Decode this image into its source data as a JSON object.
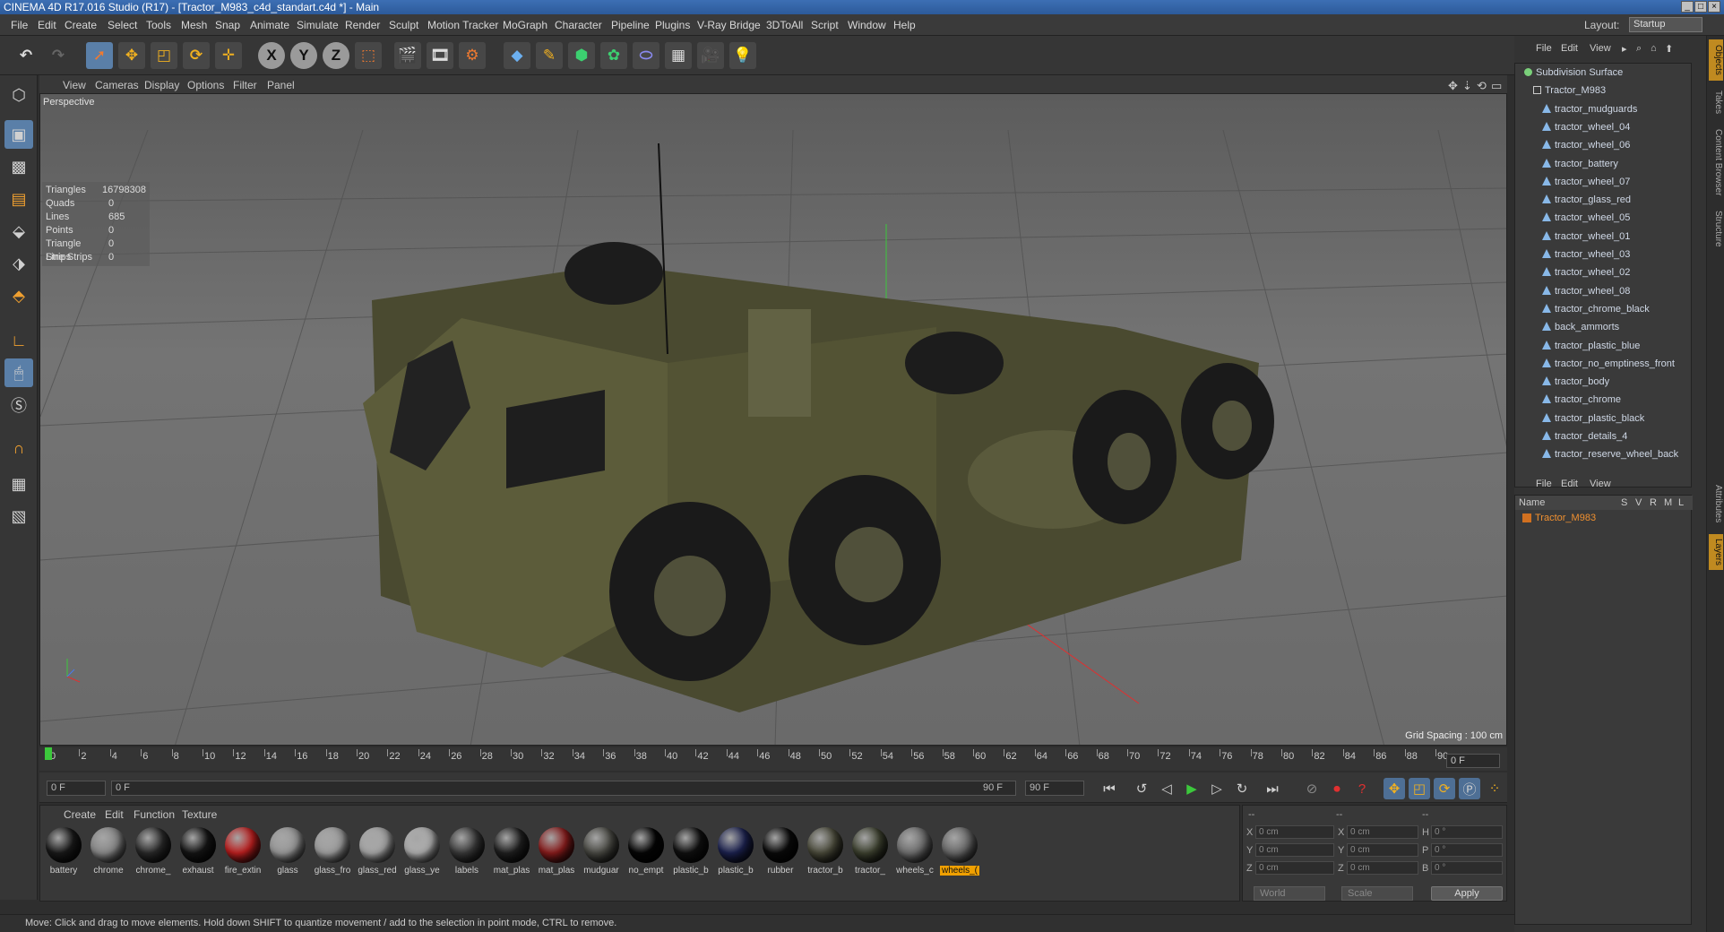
{
  "window": {
    "title": "CINEMA 4D R17.016 Studio (R17) - [Tractor_M983_c4d_standart.c4d *] - Main"
  },
  "menubar": {
    "items": [
      "File",
      "Edit",
      "Create",
      "Select",
      "Tools",
      "Mesh",
      "Snap",
      "Animate",
      "Simulate",
      "Render",
      "Sculpt",
      "Motion Tracker",
      "MoGraph",
      "Character",
      "Pipeline",
      "Plugins",
      "V-Ray Bridge",
      "3DToAll",
      "Script",
      "Window",
      "Help"
    ],
    "layout_label": "Layout:",
    "layout_value": "Startup"
  },
  "viewport": {
    "menu": [
      "View",
      "Cameras",
      "Display",
      "Options",
      "Filter",
      "Panel"
    ],
    "camera_label": "Perspective",
    "stats": [
      {
        "k": "Triangles",
        "v": "16798308"
      },
      {
        "k": "Quads",
        "v": "0"
      },
      {
        "k": "Lines",
        "v": "685"
      },
      {
        "k": "Points",
        "v": "0"
      },
      {
        "k": "Triangle Strips",
        "v": "0"
      },
      {
        "k": "Line Strips",
        "v": "0"
      }
    ],
    "grid_spacing": "Grid Spacing : 100 cm"
  },
  "timeline": {
    "ticks": [
      "0",
      "2",
      "4",
      "6",
      "8",
      "10",
      "12",
      "14",
      "16",
      "18",
      "20",
      "22",
      "24",
      "26",
      "28",
      "30",
      "32",
      "34",
      "36",
      "38",
      "40",
      "42",
      "44",
      "46",
      "48",
      "50",
      "52",
      "54",
      "56",
      "58",
      "60",
      "62",
      "64",
      "66",
      "68",
      "70",
      "72",
      "74",
      "76",
      "78",
      "80",
      "82",
      "84",
      "86",
      "88",
      "90"
    ],
    "current_frame": "0 F",
    "start": "0 F",
    "range_start": "0 F",
    "range_end": "90 F",
    "end": "90 F"
  },
  "materials": {
    "menu": [
      "Create",
      "Edit",
      "Function",
      "Texture"
    ],
    "items": [
      {
        "name": "battery",
        "color": "#1a1a1a"
      },
      {
        "name": "chrome",
        "color": "#8a8a8a"
      },
      {
        "name": "chrome_",
        "color": "#2a2a2a"
      },
      {
        "name": "exhaust",
        "color": "#151515"
      },
      {
        "name": "fire_extin",
        "color": "#c02020"
      },
      {
        "name": "glass",
        "color": "#9a9a9a"
      },
      {
        "name": "glass_fro",
        "color": "#a0a0a0"
      },
      {
        "name": "glass_red",
        "color": "#a8a8a8"
      },
      {
        "name": "glass_ye",
        "color": "#b0b0b0"
      },
      {
        "name": "labels",
        "color": "#3a3a3a"
      },
      {
        "name": "mat_plas",
        "color": "#202020"
      },
      {
        "name": "mat_plas",
        "color": "#8a1c1c"
      },
      {
        "name": "mudguar",
        "color": "#4a4a44"
      },
      {
        "name": "no_empt",
        "color": "#050505"
      },
      {
        "name": "plastic_b",
        "color": "#101010"
      },
      {
        "name": "plastic_b",
        "color": "#1c2250"
      },
      {
        "name": "rubber",
        "color": "#0a0a0a"
      },
      {
        "name": "tractor_b",
        "color": "#4a4a3a"
      },
      {
        "name": "tractor_",
        "color": "#3e4230"
      },
      {
        "name": "wheels_c",
        "color": "#707070"
      },
      {
        "name": "wheels_(",
        "color": "#6a6a6a"
      }
    ],
    "selected_index": 20
  },
  "coordinates": {
    "header": [
      "--",
      "--",
      "--"
    ],
    "rows": [
      {
        "a": "X",
        "av": "0 cm",
        "b": "X",
        "bv": "0 cm",
        "c": "H",
        "cv": "0 °"
      },
      {
        "a": "Y",
        "av": "0 cm",
        "b": "Y",
        "bv": "0 cm",
        "c": "P",
        "cv": "0 °"
      },
      {
        "a": "Z",
        "av": "0 cm",
        "b": "Z",
        "bv": "0 cm",
        "c": "B",
        "cv": "0 °"
      }
    ],
    "mode1": "World",
    "mode2": "Scale",
    "apply": "Apply"
  },
  "status": {
    "text": "Move: Click and drag to move elements. Hold down SHIFT to quantize movement / add to the selection in point mode, CTRL to remove."
  },
  "objects": {
    "menu": [
      "File",
      "Edit",
      "View"
    ],
    "items": [
      {
        "name": "Subdivision Surface",
        "indent": 0,
        "icon": "sub"
      },
      {
        "name": "Tractor_M983",
        "indent": 1,
        "icon": "null"
      },
      {
        "name": "tractor_mudguards",
        "indent": 2,
        "icon": "tri"
      },
      {
        "name": "tractor_wheel_04",
        "indent": 2,
        "icon": "tri"
      },
      {
        "name": "tractor_wheel_06",
        "indent": 2,
        "icon": "tri"
      },
      {
        "name": "tractor_battery",
        "indent": 2,
        "icon": "tri"
      },
      {
        "name": "tractor_wheel_07",
        "indent": 2,
        "icon": "tri"
      },
      {
        "name": "tractor_glass_red",
        "indent": 2,
        "icon": "tri"
      },
      {
        "name": "tractor_wheel_05",
        "indent": 2,
        "icon": "tri"
      },
      {
        "name": "tractor_wheel_01",
        "indent": 2,
        "icon": "tri"
      },
      {
        "name": "tractor_wheel_03",
        "indent": 2,
        "icon": "tri"
      },
      {
        "name": "tractor_wheel_02",
        "indent": 2,
        "icon": "tri"
      },
      {
        "name": "tractor_wheel_08",
        "indent": 2,
        "icon": "tri"
      },
      {
        "name": "tractor_chrome_black",
        "indent": 2,
        "icon": "tri"
      },
      {
        "name": "back_ammorts",
        "indent": 2,
        "icon": "tri"
      },
      {
        "name": "tractor_plastic_blue",
        "indent": 2,
        "icon": "tri"
      },
      {
        "name": "tractor_no_emptiness_front",
        "indent": 2,
        "icon": "tri"
      },
      {
        "name": "tractor_body",
        "indent": 2,
        "icon": "tri"
      },
      {
        "name": "tractor_chrome",
        "indent": 2,
        "icon": "tri"
      },
      {
        "name": "tractor_plastic_black",
        "indent": 2,
        "icon": "tri"
      },
      {
        "name": "tractor_details_4",
        "indent": 2,
        "icon": "tri"
      },
      {
        "name": "tractor_reserve_wheel_back",
        "indent": 2,
        "icon": "tri"
      }
    ]
  },
  "layers": {
    "menu": [
      "File",
      "Edit",
      "View"
    ],
    "columns": [
      "Name",
      "S",
      "V",
      "R",
      "M",
      "L"
    ],
    "row": "Tractor_M983"
  },
  "sidetabs": [
    "Objects",
    "Takes",
    "Content Browser",
    "Structure",
    "Attributes",
    "Layers"
  ]
}
